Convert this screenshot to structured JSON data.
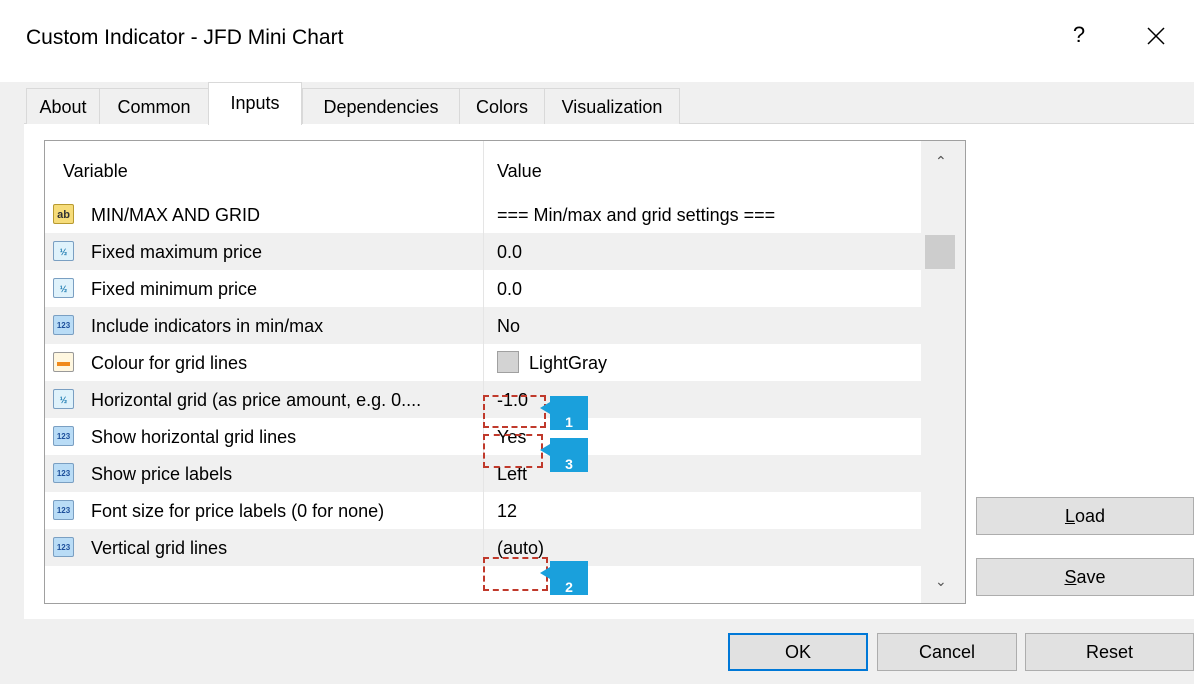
{
  "window": {
    "title": "Custom Indicator - JFD Mini Chart",
    "help_label": "?"
  },
  "tabs": [
    {
      "label": "About"
    },
    {
      "label": "Common"
    },
    {
      "label": "Inputs",
      "active": true
    },
    {
      "label": "Dependencies"
    },
    {
      "label": "Colors"
    },
    {
      "label": "Visualization"
    }
  ],
  "table": {
    "headers": {
      "variable": "Variable",
      "value": "Value"
    },
    "rows": [
      {
        "icon": "ab",
        "variable": "MIN/MAX AND GRID",
        "value": "=== Min/max and grid settings ==="
      },
      {
        "icon": "v",
        "variable": "Fixed maximum price",
        "value": "0.0"
      },
      {
        "icon": "v",
        "variable": "Fixed minimum price",
        "value": "0.0"
      },
      {
        "icon": "123",
        "variable": "Include indicators in min/max",
        "value": "No"
      },
      {
        "icon": "color",
        "variable": "Colour for grid lines",
        "value": "LightGray",
        "swatch": "#d3d3d3"
      },
      {
        "icon": "v",
        "variable": "Horizontal grid (as price amount, e.g. 0....",
        "value": "-1.0"
      },
      {
        "icon": "123",
        "variable": "Show horizontal grid lines",
        "value": "Yes"
      },
      {
        "icon": "123",
        "variable": "Show price labels",
        "value": "Left"
      },
      {
        "icon": "123",
        "variable": "Font size for price labels (0 for none)",
        "value": "12"
      },
      {
        "icon": "123",
        "variable": "Vertical grid lines",
        "value": "(auto)"
      }
    ]
  },
  "icons": {
    "ab": "ab",
    "v": "½",
    "num": "123"
  },
  "annotations": [
    {
      "number": "1"
    },
    {
      "number": "3"
    },
    {
      "number": "2"
    }
  ],
  "side_buttons": {
    "load": {
      "mnemonic": "L",
      "rest": "oad"
    },
    "save": {
      "mnemonic": "S",
      "rest": "ave"
    }
  },
  "footer": {
    "ok": "OK",
    "cancel": "Cancel",
    "reset": "Reset"
  },
  "colors": {
    "annotation": "#1aa0dc",
    "highlight_border": "#c0392b",
    "primary_border": "#0078d7"
  }
}
